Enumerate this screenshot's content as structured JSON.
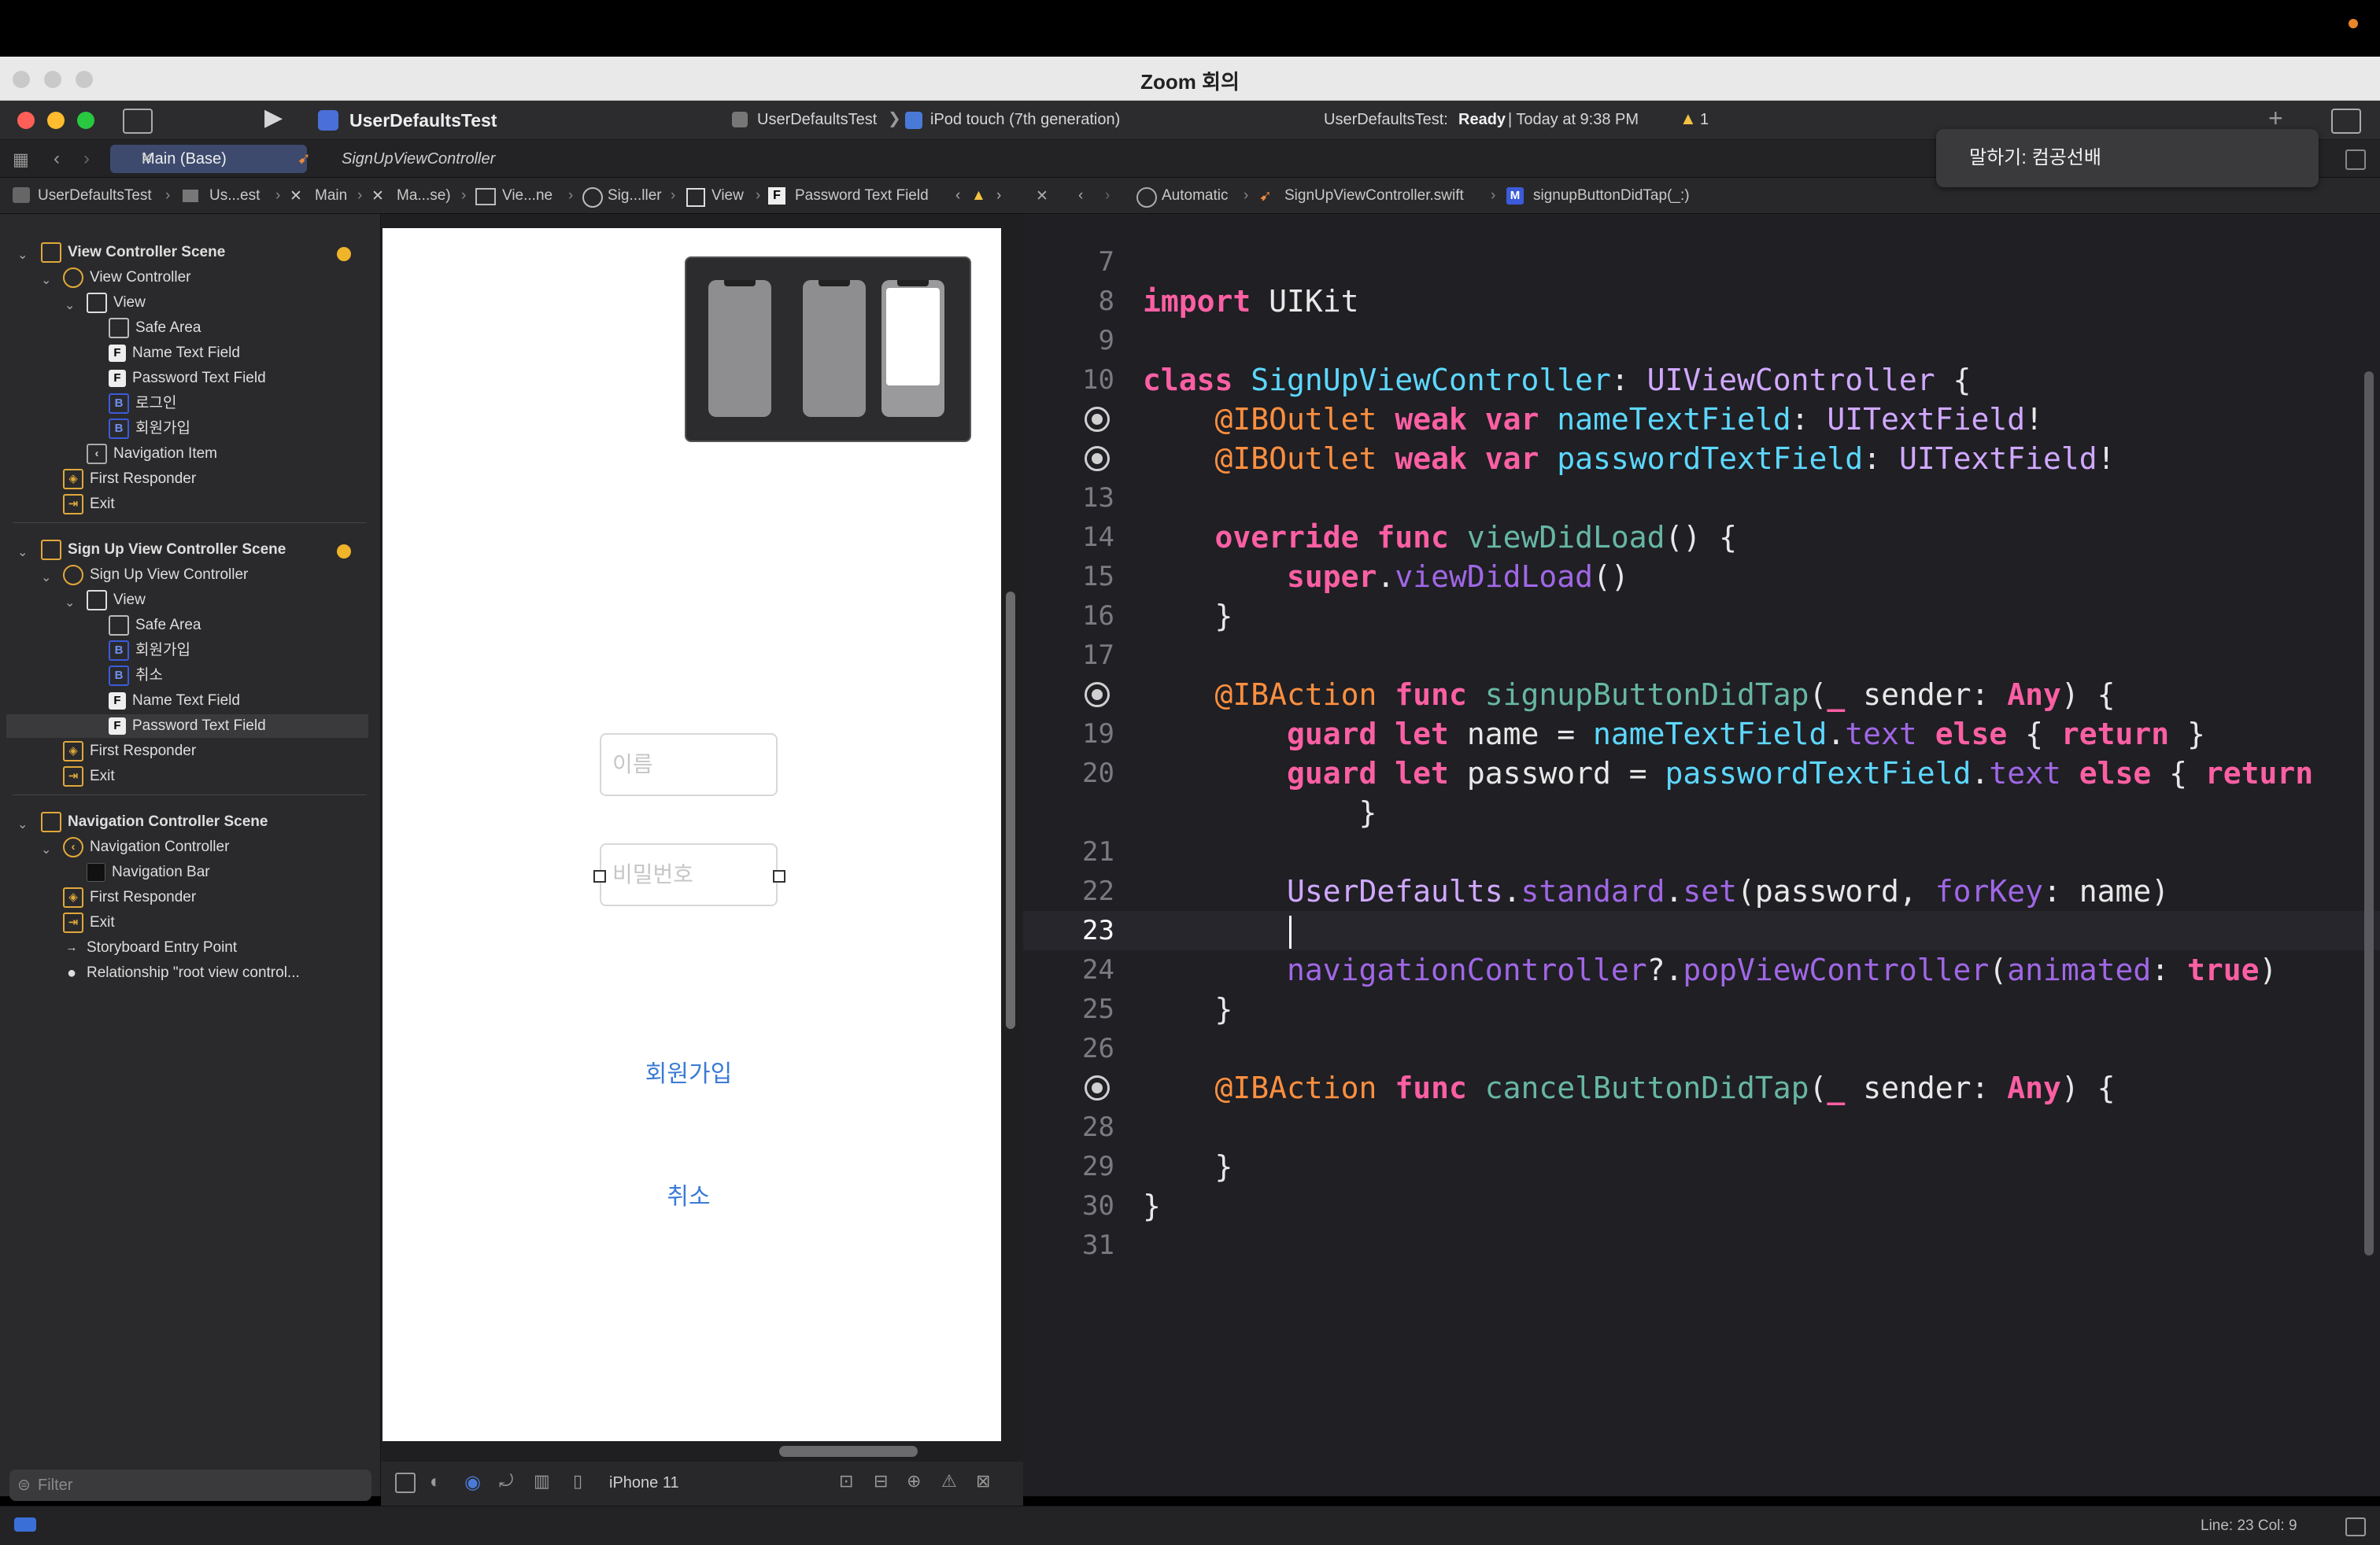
{
  "zoom_window": {
    "title": "Zoom 회의"
  },
  "toolbar": {
    "scheme": "UserDefaultsTest",
    "target": "UserDefaultsTest",
    "device": "iPod touch (7th generation)",
    "status_prefix": "UserDefaultsTest:",
    "status_state": "Ready",
    "status_time": "| Today at 9:38 PM",
    "warning_count": "1"
  },
  "tabs": [
    {
      "label": "Main (Base)"
    },
    {
      "label": "SignUpViewController"
    }
  ],
  "jumpbar_left": [
    "UserDefaultsTest",
    "Us...est",
    "Main",
    "Ma...se)",
    "Vie...ne",
    "Sig...ller",
    "View",
    "Password Text Field"
  ],
  "jumpbar_right": [
    "Automatic",
    "SignUpViewController.swift",
    "signupButtonDidTap(_:)"
  ],
  "navigator": {
    "scene1": {
      "title": "View Controller Scene",
      "items": [
        "View Controller",
        "View",
        "Safe Area",
        "Name Text Field",
        "Password Text Field",
        "로그인",
        "회원가입",
        "Navigation Item",
        "First Responder",
        "Exit"
      ]
    },
    "scene2": {
      "title": "Sign Up View Controller Scene",
      "items": [
        "Sign Up View Controller",
        "View",
        "Safe Area",
        "회원가입",
        "취소",
        "Name Text Field",
        "Password Text Field",
        "First Responder",
        "Exit"
      ]
    },
    "scene3": {
      "title": "Navigation Controller Scene",
      "items": [
        "Navigation Controller",
        "Navigation Bar",
        "First Responder",
        "Exit",
        "Storyboard Entry Point",
        "Relationship \"root view control..."
      ]
    },
    "filter_placeholder": "Filter"
  },
  "canvas": {
    "name_placeholder": "이름",
    "password_placeholder": "비밀번호",
    "signup_button": "회원가입",
    "cancel_button": "취소",
    "device_label": "iPhone 11"
  },
  "editor": {
    "lines": [
      {
        "n": "7",
        "text": ""
      },
      {
        "n": "8",
        "text": "import UIKit"
      },
      {
        "n": "9",
        "text": ""
      },
      {
        "n": "10",
        "text": "class SignUpViewController: UIViewController {"
      },
      {
        "n": "",
        "text": "    @IBOutlet weak var nameTextField: UITextField!"
      },
      {
        "n": "",
        "text": "    @IBOutlet weak var passwordTextField: UITextField!"
      },
      {
        "n": "13",
        "text": ""
      },
      {
        "n": "14",
        "text": "    override func viewDidLoad() {"
      },
      {
        "n": "15",
        "text": "        super.viewDidLoad()"
      },
      {
        "n": "16",
        "text": "    }"
      },
      {
        "n": "17",
        "text": ""
      },
      {
        "n": "",
        "text": "    @IBAction func signupButtonDidTap(_ sender: Any) {"
      },
      {
        "n": "19",
        "text": "        guard let name = nameTextField.text else { return }"
      },
      {
        "n": "20",
        "text": "        guard let password = passwordTextField.text else { return"
      },
      {
        "n": "",
        "text": "            }"
      },
      {
        "n": "21",
        "text": ""
      },
      {
        "n": "22",
        "text": "        UserDefaults.standard.set(password, forKey: name)"
      },
      {
        "n": "23",
        "text": ""
      },
      {
        "n": "24",
        "text": "        navigationController?.popViewController(animated: true)"
      },
      {
        "n": "25",
        "text": "    }"
      },
      {
        "n": "26",
        "text": ""
      },
      {
        "n": "",
        "text": "    @IBAction func cancelButtonDidTap(_ sender: Any) {"
      },
      {
        "n": "28",
        "text": ""
      },
      {
        "n": "29",
        "text": "    }"
      },
      {
        "n": "30",
        "text": "}"
      },
      {
        "n": "31",
        "text": ""
      }
    ]
  },
  "statusbar": {
    "cursor_position": "Line: 23  Col: 9"
  },
  "popup": {
    "text": "말하기: 컴공선배"
  },
  "colors": {
    "keyword": "#fc5fa3",
    "type": "#5dd8ff",
    "project_class": "#d0a8ff",
    "function": "#67b7a4",
    "attribute": "#fd8f3f",
    "ib_button": "#3a7bd5"
  }
}
